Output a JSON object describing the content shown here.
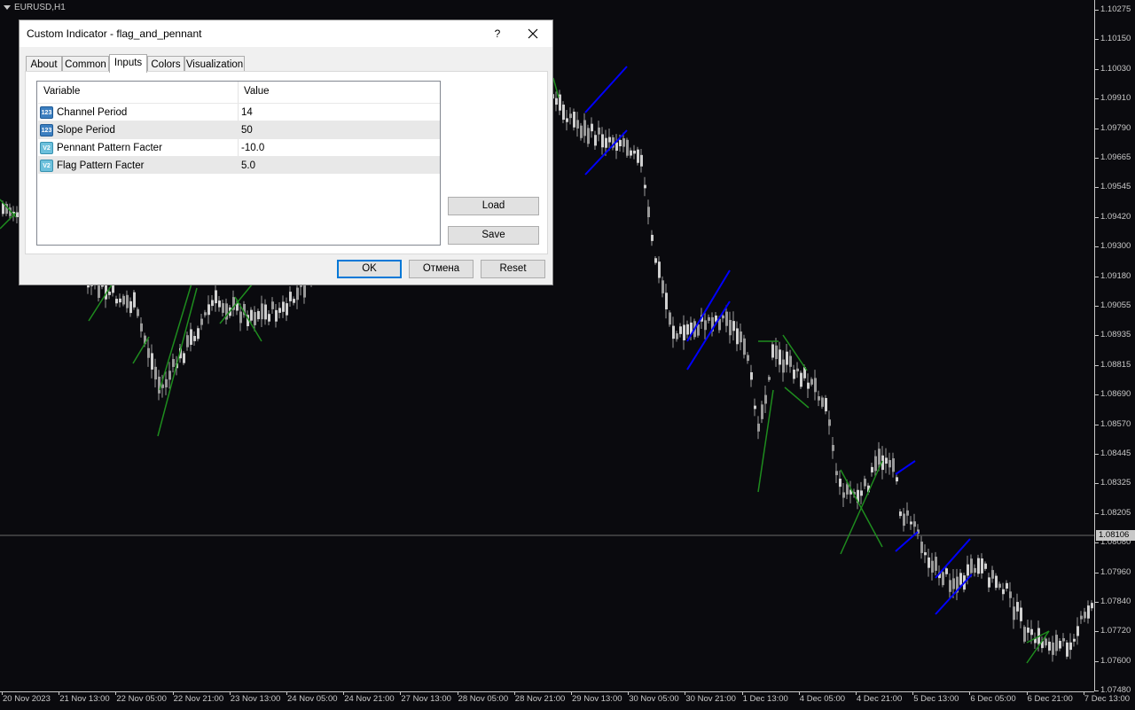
{
  "chart": {
    "symbol": "EURUSD,H1",
    "price_labels": [
      "1.10275",
      "1.10150",
      "1.10030",
      "1.09910",
      "1.09790",
      "1.09665",
      "1.09545",
      "1.09420",
      "1.09300",
      "1.09180",
      "1.09055",
      "1.08935",
      "1.08815",
      "1.08690",
      "1.08570",
      "1.08445",
      "1.08325",
      "1.08205",
      "1.08080",
      "1.07960",
      "1.07840",
      "1.07720",
      "1.07600",
      "1.07480"
    ],
    "current_price": "1.08106",
    "time_labels": [
      "20 Nov 2023",
      "21 Nov 13:00",
      "22 Nov 05:00",
      "22 Nov 21:00",
      "23 Nov 13:00",
      "24 Nov 05:00",
      "24 Nov 21:00",
      "27 Nov 13:00",
      "28 Nov 05:00",
      "28 Nov 21:00",
      "29 Nov 13:00",
      "30 Nov 05:00",
      "30 Nov 21:00",
      "1 Dec 13:00",
      "4 Dec 05:00",
      "4 Dec 21:00",
      "5 Dec 13:00",
      "6 Dec 05:00",
      "6 Dec 21:00",
      "7 Dec 13:00"
    ],
    "colors": {
      "candle": "#9a9a9a",
      "flag_line": "#0000ff",
      "pennant_line": "#1e8c1e",
      "background": "#0a0a0e",
      "axis": "#c8c8c8"
    }
  },
  "dialog": {
    "title": "Custom Indicator - flag_and_pennant",
    "help": "?",
    "close_icon": "close-icon",
    "tabs": [
      {
        "label": "About"
      },
      {
        "label": "Common"
      },
      {
        "label": "Inputs",
        "active": true
      },
      {
        "label": "Colors"
      },
      {
        "label": "Visualization"
      }
    ],
    "table": {
      "headers": [
        "Variable",
        "Value"
      ],
      "rows": [
        {
          "icon": "int-type-icon",
          "icon_text": "123",
          "name": "Channel Period",
          "value": "14"
        },
        {
          "icon": "int-type-icon",
          "icon_text": "123",
          "name": "Slope Period",
          "value": "50"
        },
        {
          "icon": "double-type-icon",
          "icon_text": "V2",
          "name": "Pennant Pattern Facter",
          "value": "-10.0"
        },
        {
          "icon": "double-type-icon",
          "icon_text": "V2",
          "name": "Flag Pattern Facter",
          "value": "5.0"
        }
      ]
    },
    "buttons": {
      "load": "Load",
      "save": "Save",
      "ok": "OK",
      "cancel": "Отмена",
      "reset": "Reset"
    }
  }
}
